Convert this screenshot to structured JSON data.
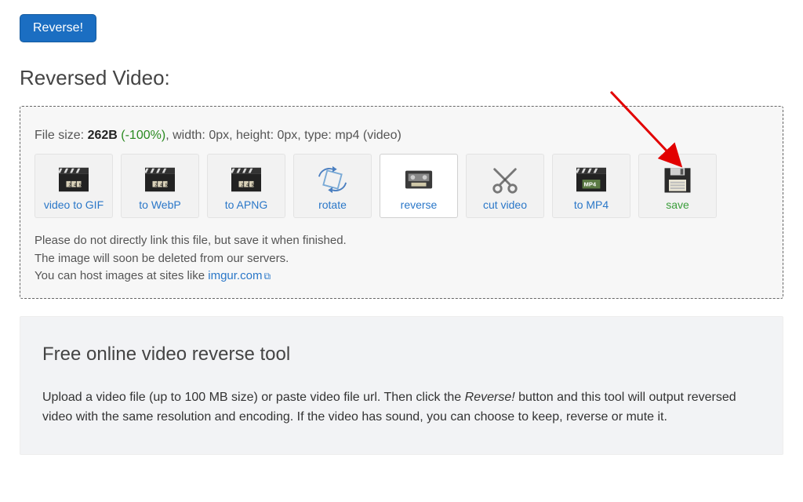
{
  "buttons": {
    "reverse": "Reverse!"
  },
  "section_title": "Reversed Video:",
  "file_info": {
    "prefix": "File size: ",
    "size": "262B",
    "pct": " (-100%)",
    "rest": ", width: 0px, height: 0px, type: mp4 (video)"
  },
  "actions": [
    {
      "id": "video-to-gif",
      "label": "video to GIF",
      "icon": "clap"
    },
    {
      "id": "to-webp",
      "label": "to WebP",
      "icon": "clap"
    },
    {
      "id": "to-apng",
      "label": "to APNG",
      "icon": "clap"
    },
    {
      "id": "rotate",
      "label": "rotate",
      "icon": "rotate"
    },
    {
      "id": "reverse",
      "label": "reverse",
      "icon": "tape",
      "active": true
    },
    {
      "id": "cut-video",
      "label": "cut video",
      "icon": "scissors"
    },
    {
      "id": "to-mp4",
      "label": "to MP4",
      "icon": "mp4"
    },
    {
      "id": "save",
      "label": "save",
      "icon": "floppy",
      "save": true
    }
  ],
  "notice": {
    "line1": "Please do not directly link this file, but save it when finished.",
    "line2": "The image will soon be deleted from our servers.",
    "line3a": "You can host images at sites like ",
    "link_text": "imgur.com"
  },
  "info": {
    "title": "Free online video reverse tool",
    "p1a": "Upload a video file (up to 100 MB size) or paste video file url. Then click the ",
    "p1_em": "Reverse!",
    "p1b": " button and this tool will output reversed video with the same resolution and encoding. If the video has sound, you can choose to keep, reverse or mute it."
  }
}
